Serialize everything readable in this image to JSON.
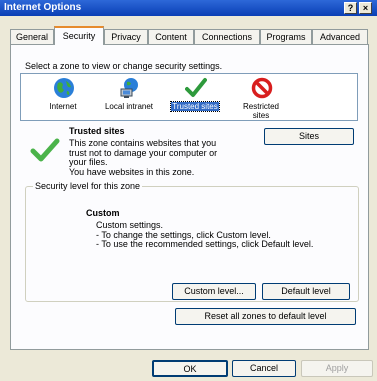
{
  "window": {
    "title": "Internet Options",
    "help": "?",
    "close": "×"
  },
  "tabs": [
    "General",
    "Security",
    "Privacy",
    "Content",
    "Connections",
    "Programs",
    "Advanced"
  ],
  "security": {
    "select_zone_text": "Select a zone to view or change security settings.",
    "zones": [
      {
        "label": "Internet",
        "icon": "globe-icon"
      },
      {
        "label": "Local intranet",
        "icon": "network-icon"
      },
      {
        "label": "Trusted sites",
        "icon": "checkmark-icon"
      },
      {
        "label": "Restricted",
        "label2": "sites",
        "icon": "restricted-icon"
      }
    ],
    "zone_title": "Trusted sites",
    "zone_desc": [
      "This zone contains websites that you",
      "trust not to damage your computer or",
      "your files.",
      "You have websites in this zone."
    ],
    "sites_button": "Sites",
    "level_group": "Security level for this zone",
    "level_title": "Custom",
    "level_desc": [
      "Custom settings.",
      "- To change the settings, click Custom level.",
      "- To use the recommended settings, click Default level."
    ],
    "custom_level_button": "Custom level...",
    "default_level_button": "Default level",
    "reset_all_button": "Reset all zones to default level"
  },
  "footer": {
    "ok": "OK",
    "cancel": "Cancel",
    "apply": "Apply"
  },
  "colors": {
    "titlebar": "#0a3fb5",
    "dialog_bg": "#ece9d8",
    "selection": "#316ac5"
  }
}
